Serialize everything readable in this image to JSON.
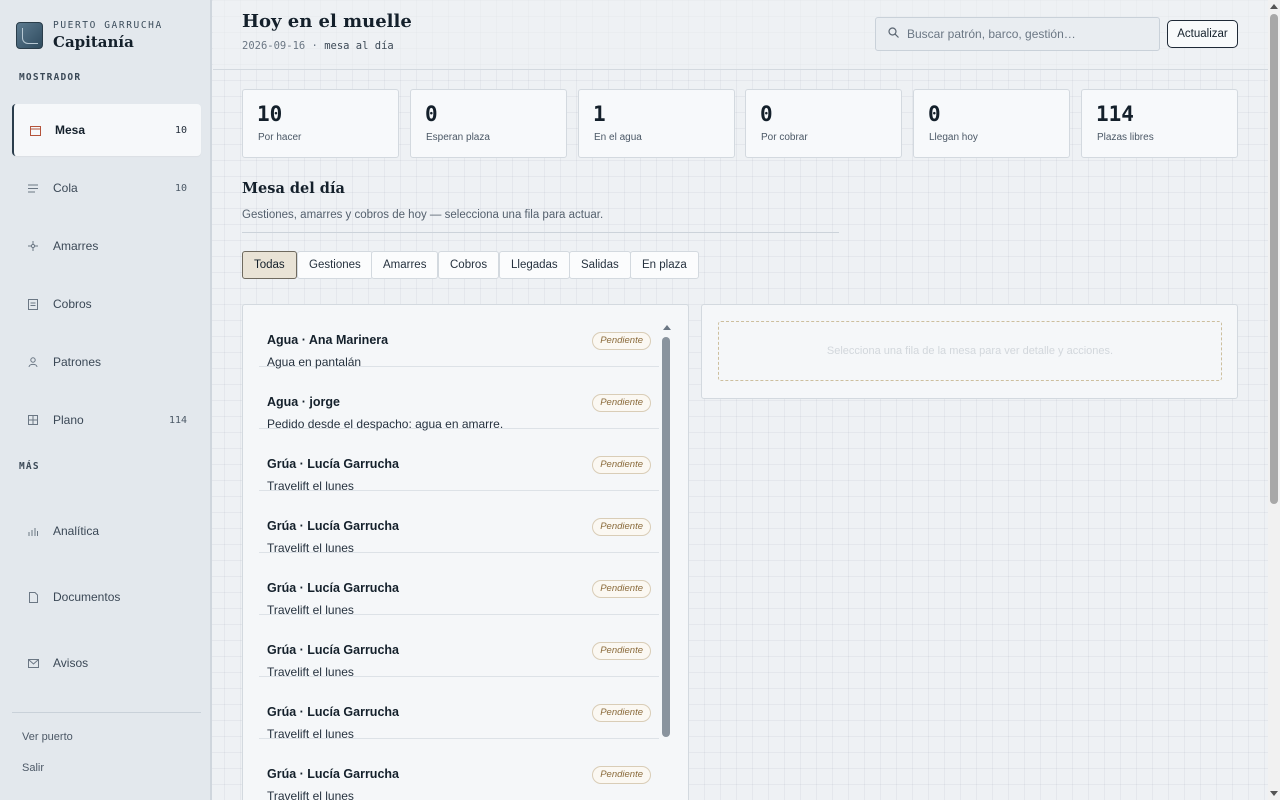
{
  "brand": {
    "kicker": "PUERTO GARRUCHA",
    "name": "Capitanía"
  },
  "sidebar": {
    "section_main": "MOSTRADOR",
    "items": [
      {
        "label": "Mesa",
        "count": "10",
        "icon": "calendar-icon",
        "active": true
      },
      {
        "label": "Cola",
        "count": "10",
        "icon": "lines-icon"
      },
      {
        "label": "Amarres",
        "count": "",
        "icon": "anchor-icon"
      },
      {
        "label": "Cobros",
        "count": "",
        "icon": "receipt-icon"
      },
      {
        "label": "Patrones",
        "count": "",
        "icon": "person-icon"
      },
      {
        "label": "Plano",
        "count": "114",
        "icon": "grid-icon"
      }
    ],
    "section_more": "MÁS",
    "more_items": [
      {
        "label": "Analítica",
        "icon": "bar-chart-icon"
      },
      {
        "label": "Documentos",
        "icon": "document-icon"
      },
      {
        "label": "Avisos",
        "icon": "mail-icon"
      }
    ],
    "footer": {
      "view_port": "Ver puerto",
      "logout": "Salir"
    }
  },
  "header": {
    "title": "Hoy en el muelle",
    "date": "2026-09-16",
    "separator": "·",
    "subtitle": "mesa al día",
    "search_placeholder": "Buscar patrón, barco, gestión…",
    "refresh_label": "Actualizar"
  },
  "stats": [
    {
      "value": "10",
      "label": "Por hacer"
    },
    {
      "value": "0",
      "label": "Esperan plaza"
    },
    {
      "value": "1",
      "label": "En el agua"
    },
    {
      "value": "0",
      "label": "Por cobrar"
    },
    {
      "value": "0",
      "label": "Llegan hoy"
    },
    {
      "value": "114",
      "label": "Plazas libres"
    }
  ],
  "desk": {
    "title": "Mesa del día",
    "description": "Gestiones, amarres y cobros de hoy — selecciona una fila para actuar.",
    "filters": [
      "Todas",
      "Gestiones",
      "Amarres",
      "Cobros",
      "Llegadas",
      "Salidas",
      "En plaza"
    ],
    "active_filter": "Todas",
    "rows": [
      {
        "title": "Agua · Ana Marinera",
        "desc": "Agua en pantalán",
        "status": "Pendiente"
      },
      {
        "title": "Agua · jorge",
        "desc": "Pedido desde el despacho: agua en amarre.",
        "status": "Pendiente"
      },
      {
        "title": "Grúa · Lucía Garrucha",
        "desc": "Travelift el lunes",
        "status": "Pendiente"
      },
      {
        "title": "Grúa · Lucía Garrucha",
        "desc": "Travelift el lunes",
        "status": "Pendiente"
      },
      {
        "title": "Grúa · Lucía Garrucha",
        "desc": "Travelift el lunes",
        "status": "Pendiente"
      },
      {
        "title": "Grúa · Lucía Garrucha",
        "desc": "Travelift el lunes",
        "status": "Pendiente"
      },
      {
        "title": "Grúa · Lucía Garrucha",
        "desc": "Travelift el lunes",
        "status": "Pendiente"
      },
      {
        "title": "Grúa · Lucía Garrucha",
        "desc": "Travelift el lunes",
        "status": "Pendiente"
      }
    ],
    "detail_empty": "Selecciona una fila de la mesa para ver detalle y acciones."
  },
  "colors": {
    "accent": "#b4533a",
    "ink": "#14202b",
    "badge_text": "#8a6a3a"
  }
}
